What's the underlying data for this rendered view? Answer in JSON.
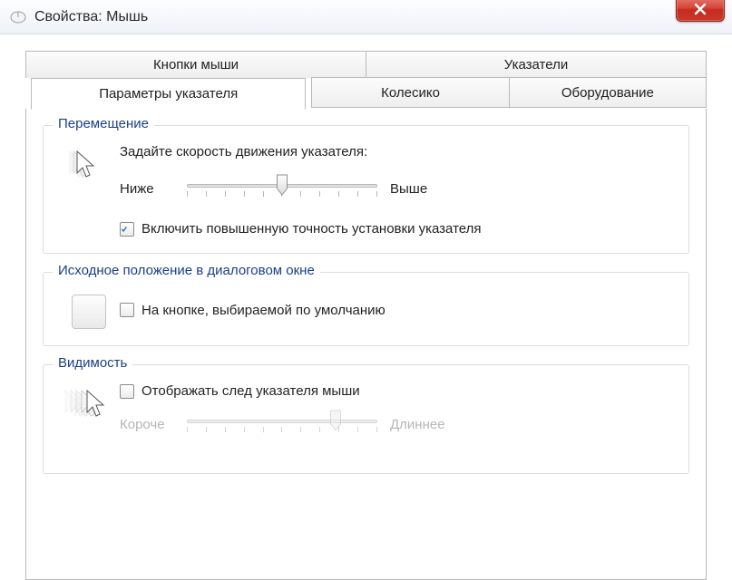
{
  "window": {
    "title": "Свойства: Мышь"
  },
  "tabs": {
    "buttons": "Кнопки мыши",
    "pointers": "Указатели",
    "pointer_options": "Параметры указателя",
    "wheel": "Колесико",
    "hardware": "Оборудование"
  },
  "motion": {
    "legend": "Перемещение",
    "instruction": "Задайте скорость движения указателя:",
    "slow": "Ниже",
    "fast": "Выше",
    "slider_value": 50,
    "enhance_precision_checked": true,
    "enhance_precision_label": "Включить повышенную точность установки указателя"
  },
  "snap": {
    "legend": "Исходное положение в диалоговом окне",
    "checkbox_checked": false,
    "checkbox_label": "На кнопке, выбираемой по умолчанию"
  },
  "visibility": {
    "legend": "Видимость",
    "trails_checked": false,
    "trails_label": "Отображать след указателя мыши",
    "short": "Короче",
    "long": "Длиннее",
    "slider_value": 78
  }
}
